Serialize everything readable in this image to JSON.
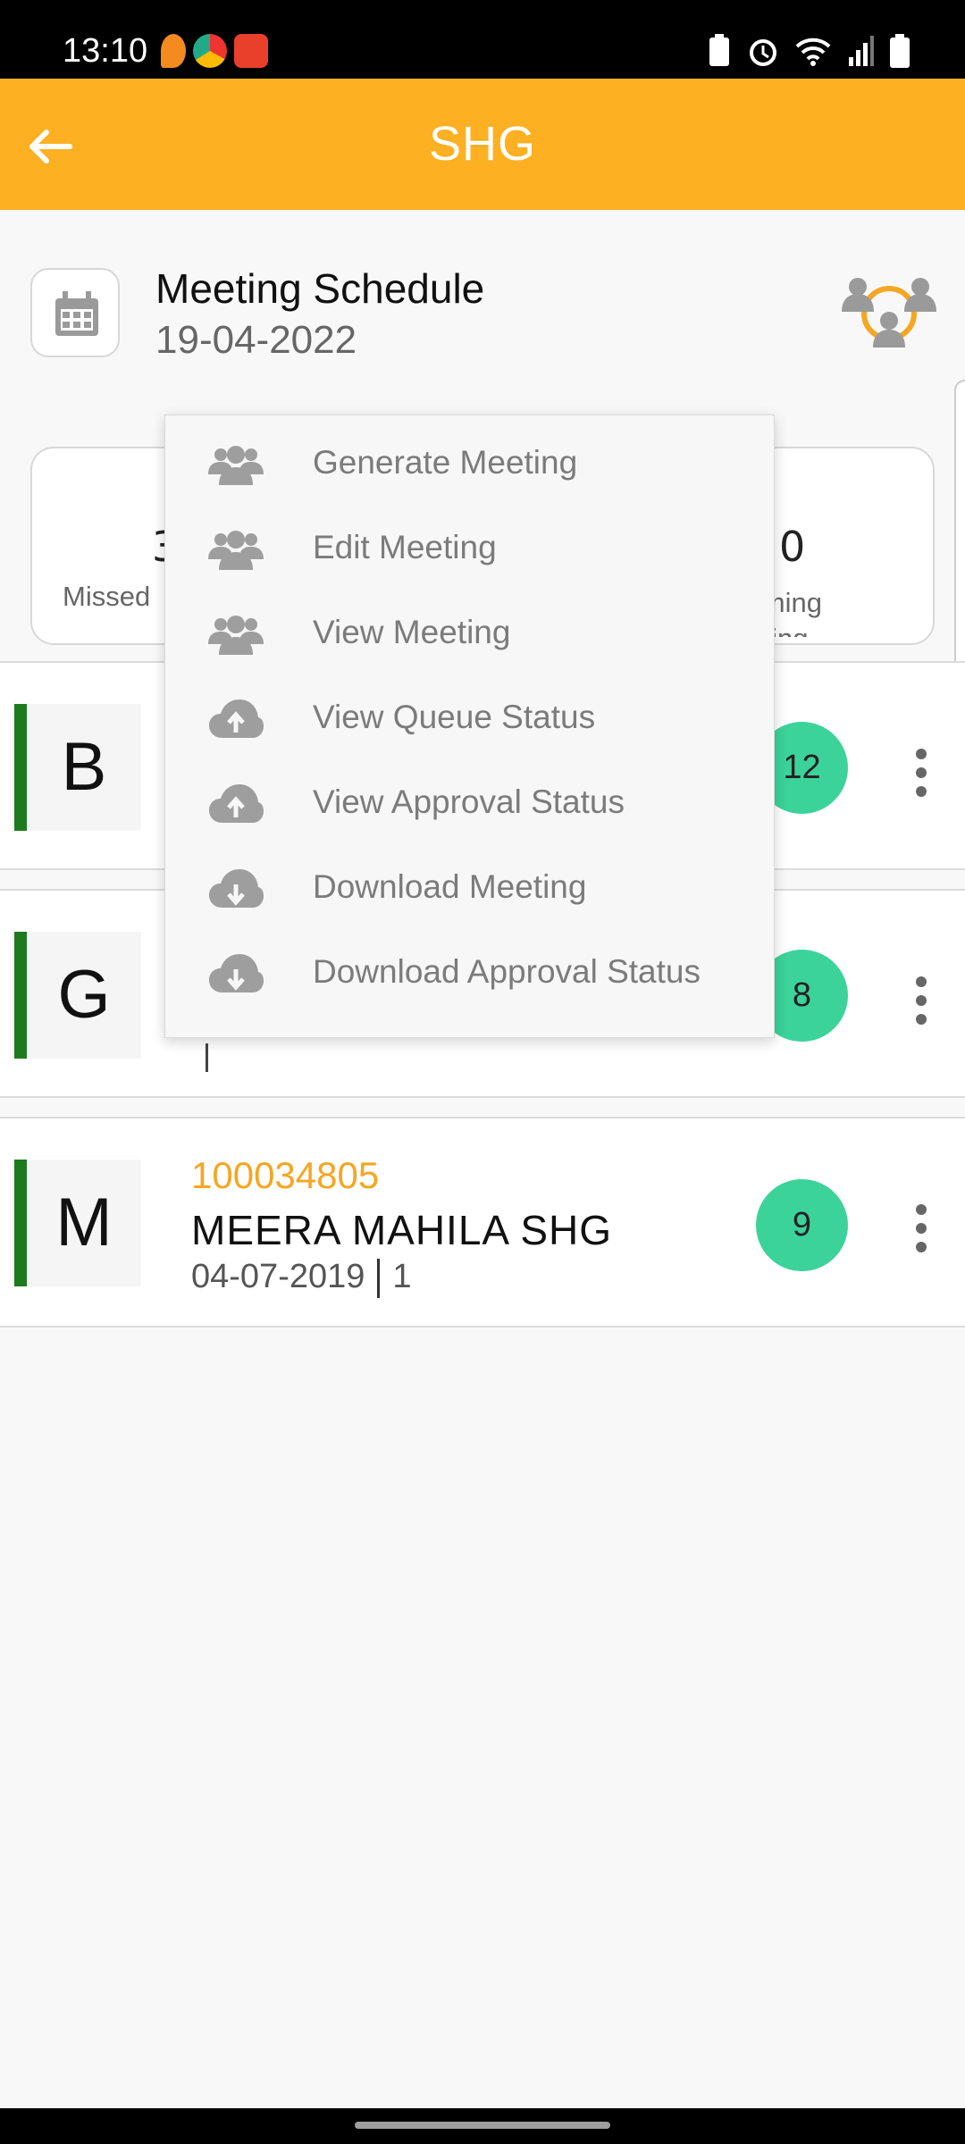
{
  "status_bar": {
    "time": "13:10"
  },
  "app_bar": {
    "title": "SHG",
    "back_icon": "arrow-left-icon"
  },
  "header": {
    "title": "Meeting Schedule",
    "date": "19-04-2022",
    "calendar_icon": "calendar-icon",
    "group_icon": "group-circle-icon"
  },
  "stats": {
    "left": {
      "number": "3",
      "label": "Missed"
    },
    "right": {
      "number": "0",
      "label": "Upcoming Meeting",
      "label_visible": "coming\neeting"
    }
  },
  "rows": [
    {
      "letter": "B",
      "badge": "12"
    },
    {
      "letter": "G",
      "badge": "8"
    },
    {
      "letter": "M",
      "code": "100034805",
      "name": "MEERA MAHILA SHG",
      "date": "04-07-2019",
      "count": "1",
      "badge": "9"
    }
  ],
  "menu": {
    "items": [
      {
        "label": "Generate Meeting",
        "icon": "group-icon"
      },
      {
        "label": "Edit Meeting",
        "icon": "group-icon"
      },
      {
        "label": "View Meeting",
        "icon": "group-icon"
      },
      {
        "label": "View Queue Status",
        "icon": "cloud-upload-icon"
      },
      {
        "label": "View Approval Status",
        "icon": "cloud-upload-icon"
      },
      {
        "label": "Download Meeting",
        "icon": "cloud-download-icon"
      },
      {
        "label": "Download Approval Status",
        "icon": "cloud-download-icon"
      }
    ]
  },
  "colors": {
    "accent": "#FDB022",
    "badge": "#3CD39B",
    "code": "#F5A623",
    "bar": "#1d7a1d"
  }
}
